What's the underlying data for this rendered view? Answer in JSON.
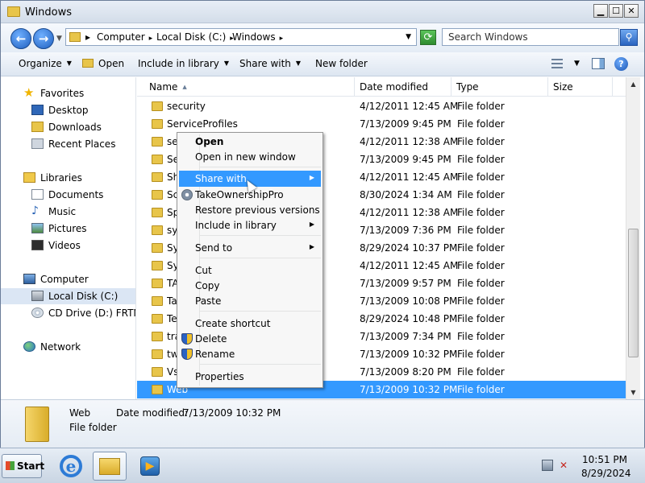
{
  "window": {
    "title": "Windows",
    "min_glyph": "0",
    "max_glyph": "1",
    "close_glyph": "r"
  },
  "address": {
    "crumbs": [
      "Computer",
      "Local Disk (C:)",
      "Windows"
    ],
    "search_placeholder": "Search Windows"
  },
  "commandbar": {
    "organize": "Organize",
    "open": "Open",
    "include": "Include in library",
    "share": "Share with",
    "new_folder": "New folder"
  },
  "navpane": {
    "favorites": "Favorites",
    "desktop": "Desktop",
    "downloads": "Downloads",
    "recent": "Recent Places",
    "libraries": "Libraries",
    "documents": "Documents",
    "music": "Music",
    "pictures": "Pictures",
    "videos": "Videos",
    "computer": "Computer",
    "local_disk": "Local Disk (C:)",
    "cd_drive": "CD Drive (D:) FRTME",
    "network": "Network"
  },
  "columns": {
    "name": "Name",
    "date": "Date modified",
    "type": "Type",
    "size": "Size"
  },
  "files": [
    {
      "name": "security",
      "date": "4/12/2011 12:45 AM",
      "type": "File folder"
    },
    {
      "name": "ServiceProfiles",
      "date": "7/13/2009 9:45 PM",
      "type": "File folder"
    },
    {
      "name": "se",
      "date": "4/12/2011 12:38 AM",
      "type": "File folder"
    },
    {
      "name": "Se",
      "date": "7/13/2009 9:45 PM",
      "type": "File folder"
    },
    {
      "name": "Sh",
      "date": "4/12/2011 12:45 AM",
      "type": "File folder"
    },
    {
      "name": "Sc",
      "date": "8/30/2024 1:34 AM",
      "type": "File folder"
    },
    {
      "name": "Sp",
      "date": "4/12/2011 12:38 AM",
      "type": "File folder"
    },
    {
      "name": "sy",
      "date": "7/13/2009 7:36 PM",
      "type": "File folder"
    },
    {
      "name": "Sy",
      "date": "8/29/2024 10:37 PM",
      "type": "File folder"
    },
    {
      "name": "Sy",
      "date": "4/12/2011 12:45 AM",
      "type": "File folder"
    },
    {
      "name": "TA",
      "date": "7/13/2009 9:57 PM",
      "type": "File folder"
    },
    {
      "name": "Ta",
      "date": "7/13/2009 10:08 PM",
      "type": "File folder"
    },
    {
      "name": "Te",
      "date": "8/29/2024 10:48 PM",
      "type": "File folder"
    },
    {
      "name": "tra",
      "date": "7/13/2009 7:34 PM",
      "type": "File folder"
    },
    {
      "name": "tw",
      "date": "7/13/2009 10:32 PM",
      "type": "File folder"
    },
    {
      "name": "Vs",
      "date": "7/13/2009 8:20 PM",
      "type": "File folder"
    },
    {
      "name": "Web",
      "date": "7/13/2009 10:32 PM",
      "type": "File folder"
    }
  ],
  "selected_row": 16,
  "details": {
    "name": "Web",
    "type": "File folder",
    "modified_label": "Date modified:",
    "modified_value": "7/13/2009 10:32 PM"
  },
  "context_menu": {
    "open": "Open",
    "open_new_window": "Open in new window",
    "share_with": "Share with",
    "take_ownership": "TakeOwnershipPro",
    "restore": "Restore previous versions",
    "include_library": "Include in library",
    "send_to": "Send to",
    "cut": "Cut",
    "copy": "Copy",
    "paste": "Paste",
    "create_shortcut": "Create shortcut",
    "delete": "Delete",
    "rename": "Rename",
    "properties": "Properties",
    "highlighted": "Share with"
  },
  "taskbar": {
    "start": "Start",
    "time": "10:51 PM",
    "date": "8/29/2024"
  },
  "colors": {
    "selection": "#3399ff",
    "titlebar": "#d3dde9",
    "folder": "#e8c54a"
  }
}
